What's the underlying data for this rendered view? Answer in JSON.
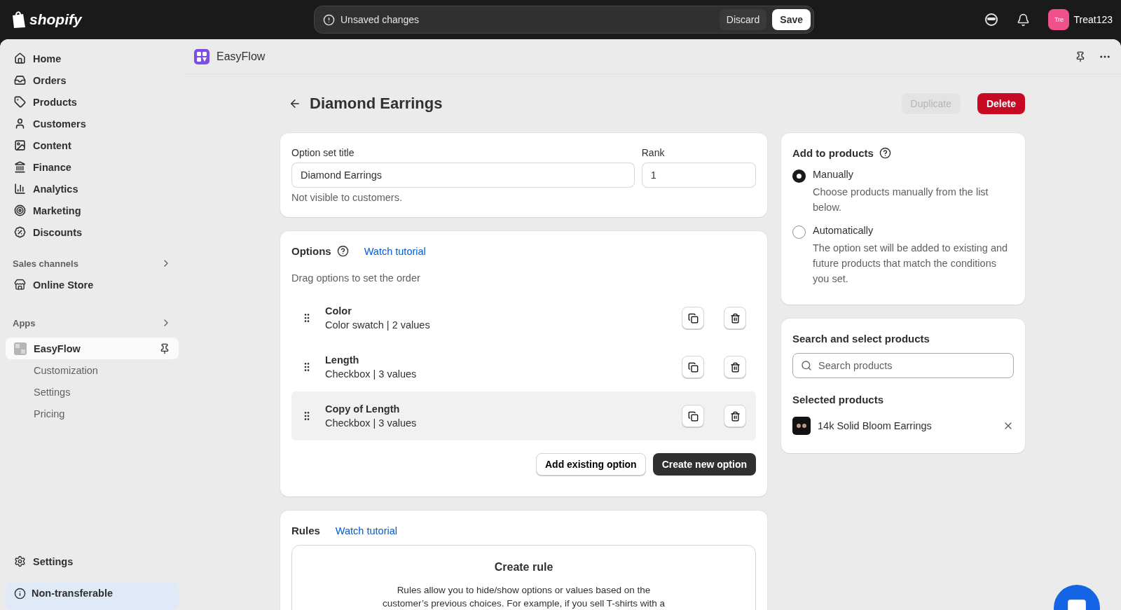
{
  "topbar": {
    "brand": "shopify",
    "unsaved": "Unsaved changes",
    "discard": "Discard",
    "save": "Save",
    "avatar": "Tre",
    "user": "Treat123"
  },
  "sidebar": {
    "items": [
      {
        "label": "Home",
        "selected": false
      },
      {
        "label": "Orders",
        "selected": false
      },
      {
        "label": "Products",
        "selected": false
      },
      {
        "label": "Customers",
        "selected": false
      },
      {
        "label": "Content",
        "selected": false
      },
      {
        "label": "Finance",
        "selected": false
      },
      {
        "label": "Analytics",
        "selected": false
      },
      {
        "label": "Marketing",
        "selected": false
      },
      {
        "label": "Discounts",
        "selected": false
      }
    ],
    "sales_heading": "Sales channels",
    "sales_items": [
      {
        "label": "Online Store",
        "selected": false
      }
    ],
    "apps_heading": "Apps",
    "app": {
      "label": "EasyFlow",
      "selected": true
    },
    "app_children": [
      {
        "label": "Customization",
        "selected": false
      },
      {
        "label": "Settings",
        "selected": false
      },
      {
        "label": "Pricing",
        "selected": false
      }
    ],
    "settings": "Settings",
    "notice": "Non-transferable"
  },
  "app_header": {
    "title": "EasyFlow"
  },
  "page": {
    "title": "Diamond Earrings",
    "duplicate": {
      "label": "Duplicate",
      "disabled": true
    },
    "delete": "Delete"
  },
  "option_set": {
    "title_label": "Option set title",
    "title_value": "Diamond Earrings",
    "rank_label": "Rank",
    "rank_value": "1",
    "help": "Not visible to customers."
  },
  "options": {
    "heading": "Options",
    "tutorial": "Watch tutorial",
    "hint": "Drag options to set the order",
    "items": [
      {
        "name": "Color",
        "detail": "Color swatch | 2 values",
        "hovered": false
      },
      {
        "name": "Length",
        "detail": "Checkbox | 3 values",
        "hovered": false
      },
      {
        "name": "Copy of Length",
        "detail": "Checkbox | 3 values",
        "hovered": true
      }
    ],
    "add_existing": "Add existing option",
    "create_new": "Create new option"
  },
  "rules": {
    "heading": "Rules",
    "tutorial": "Watch tutorial",
    "create_title": "Create rule",
    "create_text": "Rules allow you to hide/show options or values based on the customer’s previous choices. For example, if you sell T-shirts with a"
  },
  "add_to_products": {
    "heading": "Add to products",
    "choices": [
      {
        "label": "Manually",
        "description": "Choose products manually from the list below.",
        "selected": true
      },
      {
        "label": "Automatically",
        "description": "The option set will be added to existing and future products that match the conditions you set.",
        "selected": false
      }
    ]
  },
  "product_search": {
    "heading": "Search and select products",
    "placeholder": "Search products",
    "selected_heading": "Selected products",
    "products": [
      {
        "name": "14k Solid Bloom Earrings"
      }
    ]
  }
}
